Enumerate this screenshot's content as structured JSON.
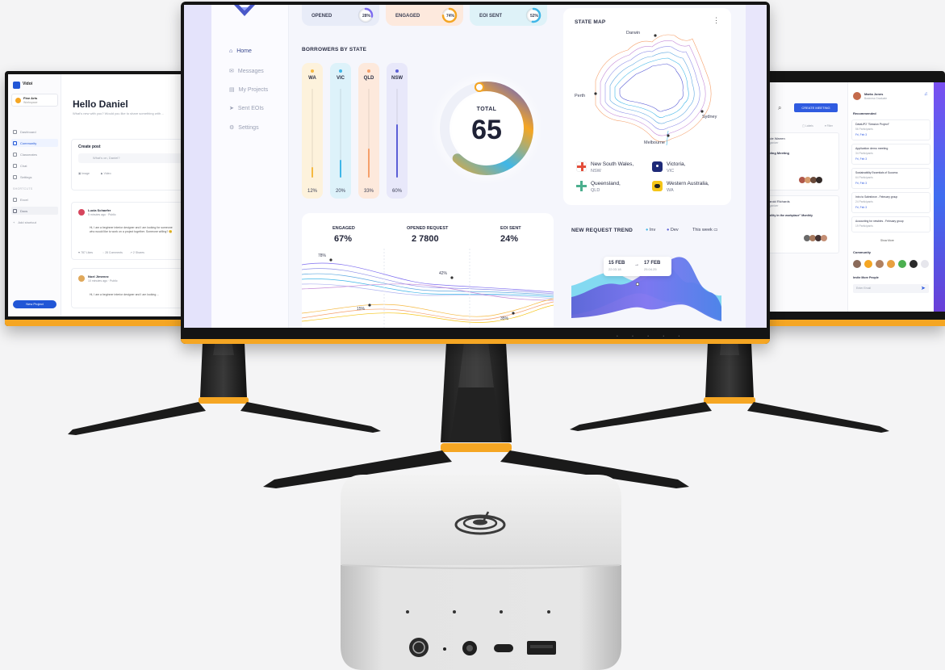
{
  "left_screen": {
    "brand": "Vidoi",
    "workspace": {
      "name": "Fine Arts",
      "sub": "Workspace"
    },
    "nav": [
      {
        "label": "Dashboard",
        "active": false
      },
      {
        "label": "Community",
        "active": true
      },
      {
        "label": "Classmates",
        "active": false
      },
      {
        "label": "Chat",
        "active": false
      },
      {
        "label": "Settings",
        "active": false
      }
    ],
    "section_label": "SHORTCUTS",
    "shortcuts": [
      "Excel",
      "Docs",
      "Add shortcut"
    ],
    "new_project": "New Project",
    "greeting": "Hello Daniel",
    "greeting_sub": "What's new with you? Would you like to share something with ...",
    "create_post": {
      "title": "Create post",
      "placeholder": "What's on, Daniel?",
      "image": "Image",
      "video": "Video"
    },
    "posts": [
      {
        "name": "Lucia Schaefer",
        "time": "5 minutes ago · Public",
        "text": "Hi, I am a beginner interior designer and I am looking for someone who would like to work on a project together. Someone willing? 😊",
        "likes": "787 Likes",
        "comments": "28 Comments",
        "shares": "2 Shares"
      },
      {
        "name": "Noel Jimenez",
        "time": "10 minutes ago · Public",
        "text": "Hi, I am a beginner interior designer and I am looking ..."
      }
    ]
  },
  "center_screen": {
    "nav": [
      {
        "label": "Home",
        "active": true
      },
      {
        "label": "Messages",
        "active": false
      },
      {
        "label": "My Projects",
        "active": false
      },
      {
        "label": "Sent EOIs",
        "active": false
      },
      {
        "label": "Settings",
        "active": false
      }
    ],
    "kpis": [
      {
        "label": "OPENED",
        "value": "28%",
        "fraction": 0.28,
        "bg": "#e8ecf8",
        "ring": "#7d6cf0"
      },
      {
        "label": "ENGAGED",
        "value": "74%",
        "fraction": 0.74,
        "bg": "#fde9dd",
        "ring": "#f5a623"
      },
      {
        "label": "EOI SENT",
        "value": "52%",
        "fraction": 0.52,
        "bg": "#def2f8",
        "ring": "#3fb6e8"
      }
    ],
    "borrowers": {
      "title": "BORROWERS BY STATE",
      "bars": [
        {
          "label": "WA",
          "value": "12%",
          "fraction": 0.12,
          "bg": "#fdf2dc",
          "color": "#f5b942"
        },
        {
          "label": "VIC",
          "value": "20%",
          "fraction": 0.2,
          "bg": "#ddf2fa",
          "color": "#3fb6e8"
        },
        {
          "label": "QLD",
          "value": "33%",
          "fraction": 0.33,
          "bg": "#fde9dc",
          "color": "#f5a06b"
        },
        {
          "label": "NSW",
          "value": "60%",
          "fraction": 0.6,
          "bg": "#e8e8fa",
          "color": "#5b5fd6"
        }
      ]
    },
    "donut": {
      "label": "TOTAL",
      "value": "65"
    },
    "state_map": {
      "title": "STATE MAP",
      "cities": [
        "Darwin",
        "Perth",
        "Sydney",
        "Melbourne"
      ],
      "legend": [
        {
          "name": "New South Wales,",
          "code": "NSW",
          "color": "#e34d3a"
        },
        {
          "name": "Victoria,",
          "code": "VIC",
          "color": "#1e2a78"
        },
        {
          "name": "Queensland,",
          "code": "QLD",
          "color": "#4caf8e"
        },
        {
          "name": "Western Australia,",
          "code": "WA",
          "color": "#f5c518"
        }
      ]
    },
    "stats": [
      {
        "label": "ENGAGED",
        "value": "67%"
      },
      {
        "label": "OPENED REQUEST",
        "value": "2 7800"
      },
      {
        "label": "EOI SENT",
        "value": "24%"
      }
    ],
    "wave_annotations": [
      "78%",
      "42%",
      "15%",
      "35%"
    ],
    "trend": {
      "title": "NEW REQUEST TREND",
      "legend": [
        {
          "name": "Inv",
          "color": "#3fb6e8"
        },
        {
          "name": "Dev",
          "color": "#5b5fd6"
        }
      ],
      "range": "This week",
      "dates": [
        {
          "date": "15 FEB",
          "sub": "22.03.18"
        },
        {
          "date": "17 FEB",
          "sub": "25.04.25"
        }
      ]
    },
    "colors": {
      "accent_orange": "#f5a623",
      "accent_blue": "#3fb6e8",
      "accent_indigo": "#5b5fd6"
    }
  },
  "right_screen": {
    "create_meeting": "CREATE MEETING",
    "user": {
      "name": "Marta Jones",
      "role": "Business Graduate"
    },
    "filters": [
      "Labels",
      "Filter"
    ],
    "events": [
      {
        "name": "Jade Warren",
        "sub": "Organizer",
        "title": "...ding Meeting"
      },
      {
        "name": "Harold Richards",
        "sub": "Organizer",
        "title": "...bility in the workplace\" Monthly"
      }
    ],
    "recommended_title": "Recommended",
    "recommended": [
      {
        "title": "DataUP2 \"Session Project\"",
        "sub": "56 Participants",
        "tag": "Fri, Feb 3"
      },
      {
        "title": "Application demo meeting",
        "sub": "34 Participants",
        "tag": "Fri, Feb 3"
      },
      {
        "title": "Sustainability Essentials of Success",
        "sub": "64 Participants",
        "tag": "Fri, Feb 3"
      },
      {
        "title": "Intro to Salesforce - February group",
        "sub": "24 Participants",
        "tag": "Fri, Feb 3"
      },
      {
        "title": "Accounting for newbies - February group",
        "sub": "19 Participants",
        "tag": ""
      }
    ],
    "show_more": "Show More",
    "community_title": "Community",
    "invite_title": "Invite More People",
    "invite_placeholder": "Enter Email"
  }
}
